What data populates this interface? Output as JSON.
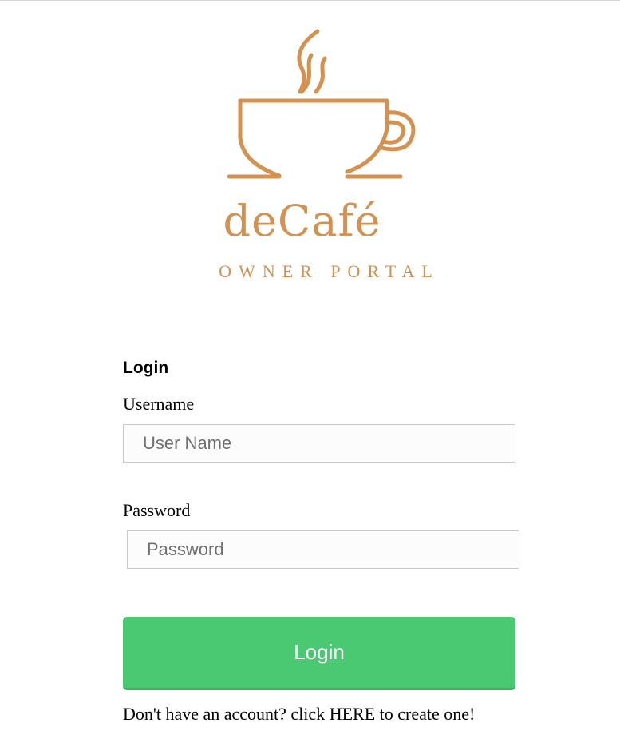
{
  "brand": {
    "name": "deCafé",
    "subtitle": "OWNER PORTAL",
    "color": "#d4914f",
    "logo_icon": "coffee-cup-icon"
  },
  "form": {
    "title": "Login",
    "username_label": "Username",
    "username_placeholder": "User Name",
    "password_label": "Password",
    "password_placeholder": "Password",
    "submit_label": "Login",
    "submit_color": "#4bc872"
  },
  "signup": {
    "prefix": "Don't have an account? click ",
    "link": "HERE",
    "suffix": " to create one!"
  }
}
